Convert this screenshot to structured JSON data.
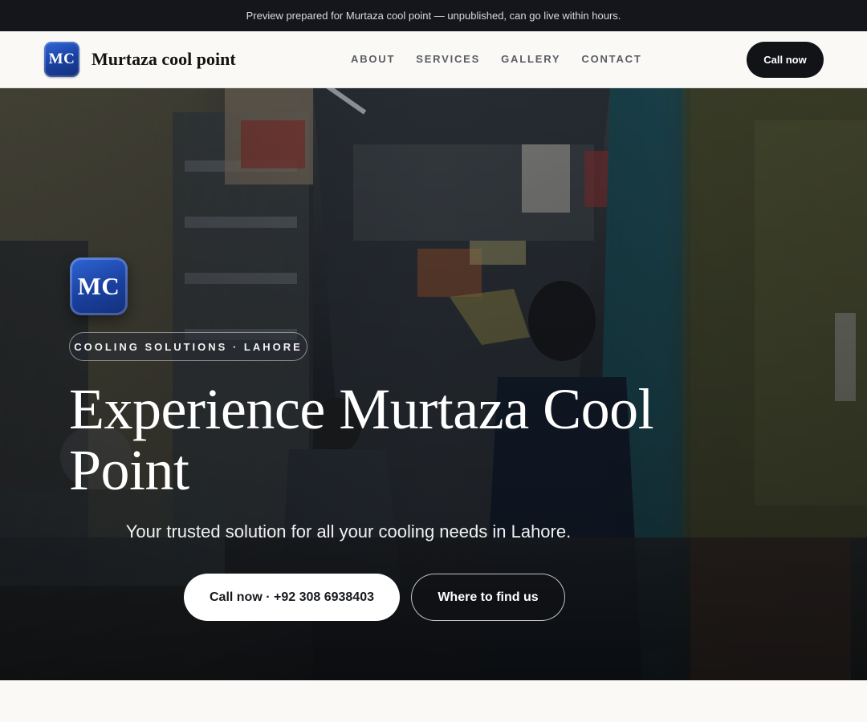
{
  "banner": {
    "text": "Preview prepared for Murtaza cool point — unpublished, can go live within hours."
  },
  "header": {
    "logo_text": "MC",
    "brand_name": "Murtaza cool point",
    "nav": [
      {
        "label": "ABOUT"
      },
      {
        "label": "SERVICES"
      },
      {
        "label": "GALLERY"
      },
      {
        "label": "CONTACT"
      }
    ],
    "cta_label": "Call now"
  },
  "hero": {
    "logo_text": "MC",
    "eyebrow": "COOLING SOLUTIONS · LAHORE",
    "title": "Experience Murtaza Cool Point",
    "subtitle": "Your trusted solution for all your cooling needs in Lahore.",
    "primary_cta": "Call now · +92 308 6938403",
    "secondary_cta": "Where to find us"
  },
  "colors": {
    "banner_bg": "#14161b",
    "page_bg": "#faf9f6",
    "dark_button": "#121317",
    "brand_blue": "#1a3f9e"
  }
}
